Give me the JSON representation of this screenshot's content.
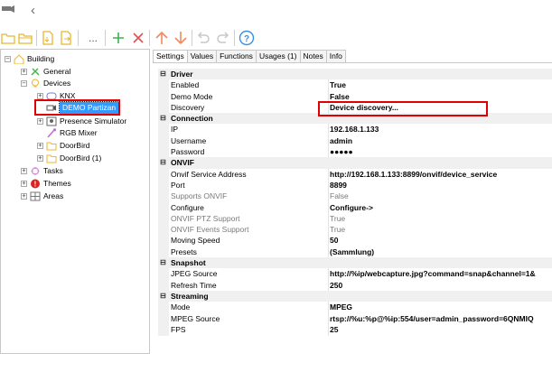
{
  "toolbar": {
    "buttons": [
      "new-folder",
      "open-folder",
      "save",
      "export",
      "more",
      "add",
      "delete",
      "move-up",
      "move-down",
      "undo",
      "redo",
      "help"
    ],
    "more_label": "..."
  },
  "tree": {
    "root": "Building",
    "items": {
      "general": "General",
      "devices": "Devices",
      "knx": "KNX",
      "demo": "DEMO Partizan",
      "presence": "Presence Simulator",
      "rgb": "RGB Mixer",
      "doorbird": "DoorBird",
      "doorbird1": "DoorBird (1)",
      "tasks": "Tasks",
      "themes": "Themes",
      "areas": "Areas"
    }
  },
  "tabs": [
    "Settings",
    "Values",
    "Functions",
    "Usages (1)",
    "Notes",
    "Info"
  ],
  "properties": {
    "driver": {
      "category": "Driver",
      "enabled_label": "Enabled",
      "enabled": "True",
      "demo_label": "Demo Mode",
      "demo": "False",
      "discovery_label": "Discovery",
      "discovery": "Device discovery..."
    },
    "connection": {
      "category": "Connection",
      "ip_label": "IP",
      "ip": "192.168.1.133",
      "user_label": "Username",
      "user": "admin",
      "pass_label": "Password",
      "pass": "●●●●●"
    },
    "onvif": {
      "category": "ONVIF",
      "svc_label": "Onvif Service Address",
      "svc": "http://192.168.1.133:8899/onvif/device_service",
      "port_label": "Port",
      "port": "8899",
      "supports_label": "Supports ONVIF",
      "supports": "False",
      "configure_label": "Configure",
      "configure": "Configure->",
      "ptz_label": "ONVIF PTZ Support",
      "ptz": "True",
      "events_label": "ONVIF Events Support",
      "events": "True",
      "speed_label": "Moving Speed",
      "speed": "50",
      "presets_label": "Presets",
      "presets": "(Sammlung)"
    },
    "snapshot": {
      "category": "Snapshot",
      "jpeg_label": "JPEG Source",
      "jpeg": "http://%ip/webcapture.jpg?command=snap&channel=1&",
      "refresh_label": "Refresh Time",
      "refresh": "250"
    },
    "streaming": {
      "category": "Streaming",
      "mode_label": "Mode",
      "mode": "MPEG",
      "mpeg_label": "MPEG Source",
      "mpeg": "rtsp://%u:%p@%ip:554/user=admin_password=6QNMIQ",
      "fps_label": "FPS",
      "fps": "25"
    }
  }
}
